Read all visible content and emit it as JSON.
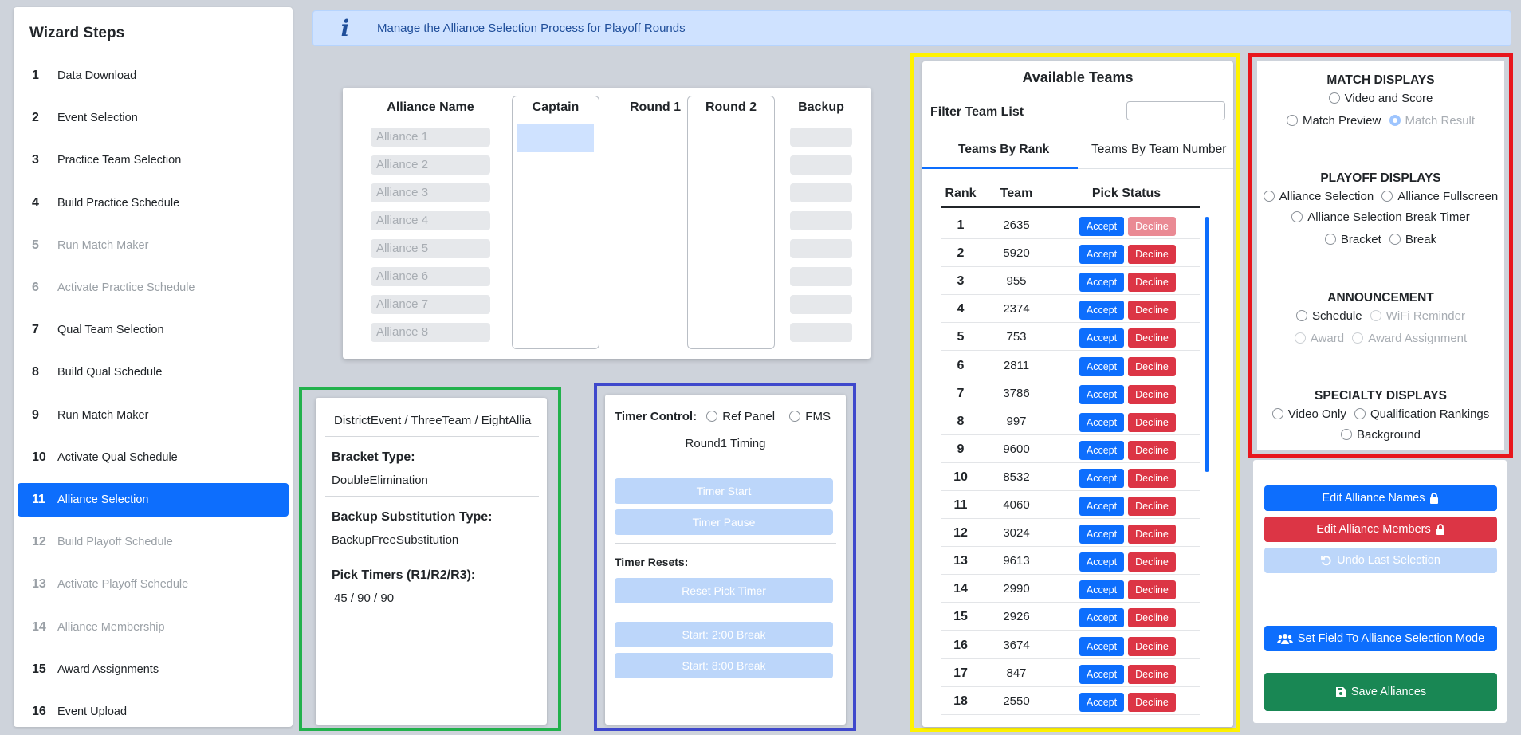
{
  "sidebar": {
    "title": "Wizard Steps",
    "steps": [
      {
        "num": "1",
        "label": "Data Download",
        "state": "normal"
      },
      {
        "num": "2",
        "label": "Event Selection",
        "state": "normal"
      },
      {
        "num": "3",
        "label": "Practice Team Selection",
        "state": "normal"
      },
      {
        "num": "4",
        "label": "Build Practice Schedule",
        "state": "normal"
      },
      {
        "num": "5",
        "label": "Run Match Maker",
        "state": "disabled"
      },
      {
        "num": "6",
        "label": "Activate Practice Schedule",
        "state": "disabled"
      },
      {
        "num": "7",
        "label": "Qual Team Selection",
        "state": "normal"
      },
      {
        "num": "8",
        "label": "Build Qual Schedule",
        "state": "normal"
      },
      {
        "num": "9",
        "label": "Run Match Maker",
        "state": "normal"
      },
      {
        "num": "10",
        "label": "Activate Qual Schedule",
        "state": "normal"
      },
      {
        "num": "11",
        "label": "Alliance Selection",
        "state": "active"
      },
      {
        "num": "12",
        "label": "Build Playoff Schedule",
        "state": "disabled"
      },
      {
        "num": "13",
        "label": "Activate Playoff Schedule",
        "state": "disabled"
      },
      {
        "num": "14",
        "label": "Alliance Membership",
        "state": "disabled"
      },
      {
        "num": "15",
        "label": "Award Assignments",
        "state": "normal"
      },
      {
        "num": "16",
        "label": "Event Upload",
        "state": "normal"
      }
    ]
  },
  "banner": {
    "icon": "info-icon",
    "text": "Manage the Alliance Selection Process for Playoff Rounds"
  },
  "alliances": {
    "headers": {
      "name": "Alliance Name",
      "captain": "Captain",
      "round1": "Round 1",
      "round2": "Round 2",
      "backup": "Backup"
    },
    "names": [
      "Alliance 1",
      "Alliance 2",
      "Alliance 3",
      "Alliance 4",
      "Alliance 5",
      "Alliance 6",
      "Alliance 7",
      "Alliance 8"
    ]
  },
  "event_info": {
    "format": "DistrictEvent / ThreeTeam / EightAllia",
    "bracket_label": "Bracket Type:",
    "bracket_value": "DoubleElimination",
    "backup_label": "Backup Substitution Type:",
    "backup_value": "BackupFreeSubstitution",
    "timers_label": "Pick Timers (R1/R2/R3):",
    "timers_value": "45 / 90 / 90"
  },
  "timer": {
    "control_label": "Timer Control:",
    "ref_panel": "Ref Panel",
    "fms": "FMS",
    "timing_label": "Round1 Timing",
    "start": "Timer Start",
    "pause": "Timer Pause",
    "resets_label": "Timer Resets:",
    "reset_pick": "Reset Pick Timer",
    "break_2": "Start: 2:00 Break",
    "break_8": "Start: 8:00 Break"
  },
  "teams": {
    "title": "Available Teams",
    "filter_label": "Filter Team List",
    "filter_value": "",
    "tab_rank": "Teams By Rank",
    "tab_number": "Teams By Team Number",
    "col_rank": "Rank",
    "col_team": "Team",
    "col_status": "Pick Status",
    "accept_label": "Accept",
    "decline_label": "Decline",
    "rows": [
      {
        "rank": "1",
        "team": "2635",
        "decline_disabled": true
      },
      {
        "rank": "2",
        "team": "5920",
        "decline_disabled": false
      },
      {
        "rank": "3",
        "team": "955",
        "decline_disabled": false
      },
      {
        "rank": "4",
        "team": "2374",
        "decline_disabled": false
      },
      {
        "rank": "5",
        "team": "753",
        "decline_disabled": false
      },
      {
        "rank": "6",
        "team": "2811",
        "decline_disabled": false
      },
      {
        "rank": "7",
        "team": "3786",
        "decline_disabled": false
      },
      {
        "rank": "8",
        "team": "997",
        "decline_disabled": false
      },
      {
        "rank": "9",
        "team": "9600",
        "decline_disabled": false
      },
      {
        "rank": "10",
        "team": "8532",
        "decline_disabled": false
      },
      {
        "rank": "11",
        "team": "4060",
        "decline_disabled": false
      },
      {
        "rank": "12",
        "team": "3024",
        "decline_disabled": false
      },
      {
        "rank": "13",
        "team": "9613",
        "decline_disabled": false
      },
      {
        "rank": "14",
        "team": "2990",
        "decline_disabled": false
      },
      {
        "rank": "15",
        "team": "2926",
        "decline_disabled": false
      },
      {
        "rank": "16",
        "team": "3674",
        "decline_disabled": false
      },
      {
        "rank": "17",
        "team": "847",
        "decline_disabled": false
      },
      {
        "rank": "18",
        "team": "2550",
        "decline_disabled": false
      }
    ]
  },
  "displays": {
    "match_title": "MATCH DISPLAYS",
    "video_score": "Video and Score",
    "match_preview": "Match Preview",
    "match_result": "Match Result",
    "playoff_title": "PLAYOFF DISPLAYS",
    "alliance_selection": "Alliance Selection",
    "alliance_fullscreen": "Alliance Fullscreen",
    "alliance_break_timer": "Alliance Selection Break Timer",
    "bracket": "Bracket",
    "break": "Break",
    "announce_title": "ANNOUNCEMENT",
    "schedule": "Schedule",
    "wifi_reminder": "WiFi Reminder",
    "award": "Award",
    "award_assignment": "Award Assignment",
    "specialty_title": "SPECIALTY DISPLAYS",
    "video_only": "Video Only",
    "qual_rankings": "Qualification Rankings",
    "background": "Background"
  },
  "actions": {
    "edit_names": "Edit Alliance Names",
    "edit_members": "Edit Alliance Members",
    "undo": "Undo Last Selection",
    "set_field": "Set Field To Alliance Selection Mode",
    "save": "Save Alliances"
  },
  "colors": {
    "primary": "#0d6efd",
    "danger": "#dc3545",
    "success": "#198754",
    "highlight_green": "#22b14c",
    "highlight_blue": "#3f48cc",
    "highlight_yellow": "#fff200",
    "highlight_red": "#e8161d"
  }
}
